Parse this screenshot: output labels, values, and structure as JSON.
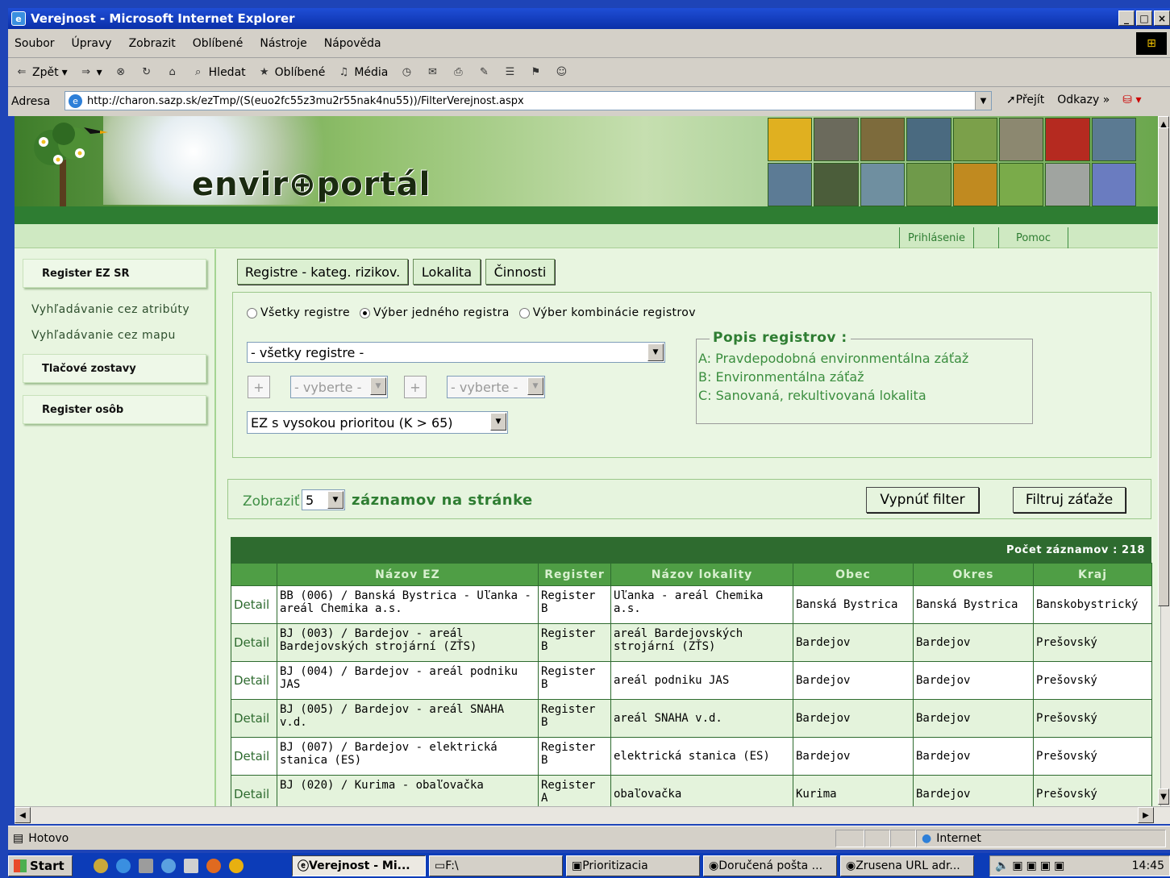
{
  "window": {
    "title": "Verejnost - Microsoft Internet Explorer"
  },
  "menu": [
    "Soubor",
    "Úpravy",
    "Zobrazit",
    "Oblíbené",
    "Nástroje",
    "Nápověda"
  ],
  "toolbar": {
    "back": "Zpět",
    "search": "Hledat",
    "favorites": "Oblíbené",
    "media": "Média"
  },
  "address": {
    "label": "Adresa",
    "url": "http://charon.sazp.sk/ezTmp/(S(euo2fc55z3mu2r55nak4nu55))/FilterVerejnost.aspx",
    "go": "Přejít",
    "links": "Odkazy"
  },
  "banner": {
    "logo": "envir⊕portál"
  },
  "nav": {
    "login": "Prihlásenie",
    "help": "Pomoc"
  },
  "sidebar": {
    "register_ez": "Register EZ SR",
    "search_attr": "Vyhľadávanie cez atribúty",
    "search_map": "Vyhľadávanie cez mapu",
    "reports": "Tlačové zostavy",
    "persons": "Register osôb"
  },
  "tabs": [
    "Registre - kateg. rizikov.",
    "Lokalita",
    "Činnosti"
  ],
  "filter": {
    "radio_all": "Všetky registre",
    "radio_one": "Výber jedného registra",
    "radio_combo": "Výber kombinácie registrov",
    "selected_radio": "radio_one",
    "registry_select": "- všetky registre -",
    "combo_plus": "+",
    "combo_select1": "- vyberte -",
    "combo_select2": "- vyberte -",
    "priority_select": "EZ s vysokou prioritou (K > 65)"
  },
  "popis": {
    "title": "Popis registrov :",
    "a": "A: Pravdepodobná environmentálna záťaž",
    "b": "B: Environmentálna záťaž",
    "c": "C: Sanovaná, rekultivovaná lokalita"
  },
  "paging": {
    "show_label": "Zobraziť",
    "page_size": "5",
    "records_label": "záznamov na stránke",
    "btn_off": "Vypnúť filter",
    "btn_filter": "Filtruj záťaže"
  },
  "table": {
    "count": "Počet záznamov : 218",
    "headers": [
      "",
      "Názov EZ",
      "Register",
      "Názov lokality",
      "Obec",
      "Okres",
      "Kraj"
    ],
    "rows": [
      {
        "detail": "Detail",
        "nazov": "BB (006) / Banská Bystrica - Uľanka - areál Chemika a.s.",
        "register": "Register B",
        "lokalita": "Uľanka - areál Chemika a.s.",
        "obec": "Banská Bystrica",
        "okres": "Banská Bystrica",
        "kraj": "Banskobystrický"
      },
      {
        "detail": "Detail",
        "nazov": "BJ (003) / Bardejov - areál Bardejovských strojární (ZŤS)",
        "register": "Register B",
        "lokalita": "areál Bardejovských strojární (ZŤS)",
        "obec": "Bardejov",
        "okres": "Bardejov",
        "kraj": "Prešovský"
      },
      {
        "detail": "Detail",
        "nazov": "BJ (004) / Bardejov - areál podniku JAS",
        "register": "Register B",
        "lokalita": "areál podniku JAS",
        "obec": "Bardejov",
        "okres": "Bardejov",
        "kraj": "Prešovský"
      },
      {
        "detail": "Detail",
        "nazov": "BJ (005) / Bardejov - areál SNAHA v.d.",
        "register": "Register B",
        "lokalita": "areál SNAHA v.d.",
        "obec": "Bardejov",
        "okres": "Bardejov",
        "kraj": "Prešovský"
      },
      {
        "detail": "Detail",
        "nazov": "BJ (007) / Bardejov - elektrická stanica (ES)",
        "register": "Register B",
        "lokalita": "elektrická stanica (ES)",
        "obec": "Bardejov",
        "okres": "Bardejov",
        "kraj": "Prešovský"
      },
      {
        "detail": "Detail",
        "nazov": "BJ (020) / Kurima - obaľovačka",
        "register": "Register A",
        "lokalita": "obaľovačka",
        "obec": "Kurima",
        "okres": "Bardejov",
        "kraj": "Prešovský"
      }
    ]
  },
  "status": {
    "text": "Hotovo",
    "zone": "Internet"
  },
  "taskbar": {
    "start": "Start",
    "tasks": [
      "Verejnost - Mi...",
      "F:\\",
      "Prioritizacia",
      "Doručená pošta ...",
      "Zrusena URL adr..."
    ],
    "time": "14:45"
  }
}
